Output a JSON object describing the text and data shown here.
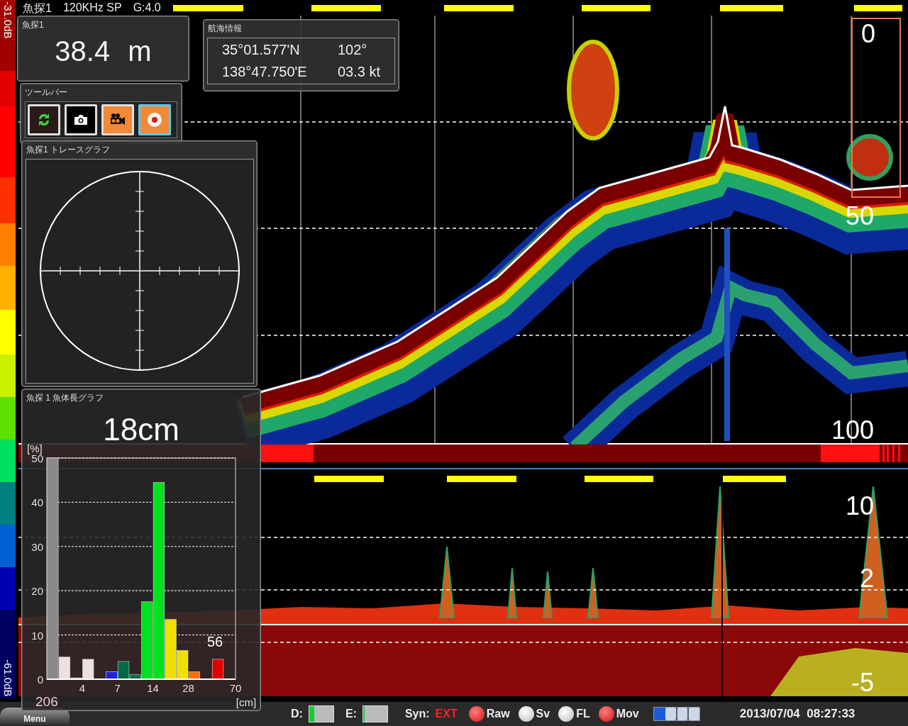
{
  "color_scale": {
    "top": "-31.0dB",
    "bottom": "-61.0dB"
  },
  "header": {
    "channel": "魚探1",
    "frequency": "120KHz SP",
    "gain": "G:4.0"
  },
  "upper_echogram": {
    "depth_labels": [
      "0",
      "50",
      "100"
    ]
  },
  "lower_echogram": {
    "depth_labels": [
      "10",
      "2",
      "-5"
    ]
  },
  "depth_panel": {
    "title": "魚探1",
    "value": "38.4 m"
  },
  "nav_panel": {
    "title": "航海情報",
    "latitude": "35°01.577'N",
    "heading": "102°",
    "longitude": "138°47.750'E",
    "speed": "03.3 kt"
  },
  "toolbar": {
    "title": "ツールバー",
    "buttons": [
      {
        "kind": "refresh",
        "selected": false
      },
      {
        "kind": "camera",
        "selected": false
      },
      {
        "kind": "video",
        "selected": false
      },
      {
        "kind": "record",
        "selected": true
      }
    ]
  },
  "trace_panel": {
    "title": "魚探1 トレースグラフ"
  },
  "length_panel": {
    "title": "魚探 1 魚体長グラフ",
    "size": "18cm",
    "total": "206",
    "marker": "56",
    "chart_data": {
      "type": "bar",
      "xlabel": "[cm]",
      "ylabel": "[%]",
      "categories": [
        null,
        null,
        "4",
        null,
        null,
        "7",
        null,
        null,
        "14",
        null,
        null,
        "28",
        null,
        null,
        null,
        "70"
      ],
      "values": [
        50,
        5,
        0.3,
        4.5,
        0,
        1.7,
        4,
        1,
        17.5,
        44.5,
        13.5,
        6.5,
        1.7,
        0,
        4.5,
        0
      ],
      "colors": [
        "#8a8a8a",
        "#ece0e0",
        "#ece0e0",
        "#ece0e0",
        "#ece0e0",
        "#2020e0",
        "#006848",
        "#006848",
        "#00e020",
        "#00e020",
        "#f0e000",
        "#f0e000",
        "#f07000",
        "#e00000",
        "#e00000",
        "#e00000"
      ],
      "ylim": [
        0,
        50
      ],
      "yticks": [
        0,
        10,
        20,
        30,
        40,
        50
      ],
      "grid": true
    }
  },
  "status_bar": {
    "menu": "Menu",
    "indicators": [
      {
        "label": "D:",
        "level": 0.2
      },
      {
        "label": "E:",
        "level": 0.06
      }
    ],
    "sync_label": "Syn:",
    "sync_value": "EXT",
    "toggles": [
      {
        "label": "Raw",
        "on": true
      },
      {
        "label": "Sv",
        "on": false
      },
      {
        "label": "FL",
        "on": false
      },
      {
        "label": "Mov",
        "on": true
      }
    ],
    "progress": {
      "level": 0.25
    },
    "datetime": "2013/07/04  08:27:33"
  }
}
